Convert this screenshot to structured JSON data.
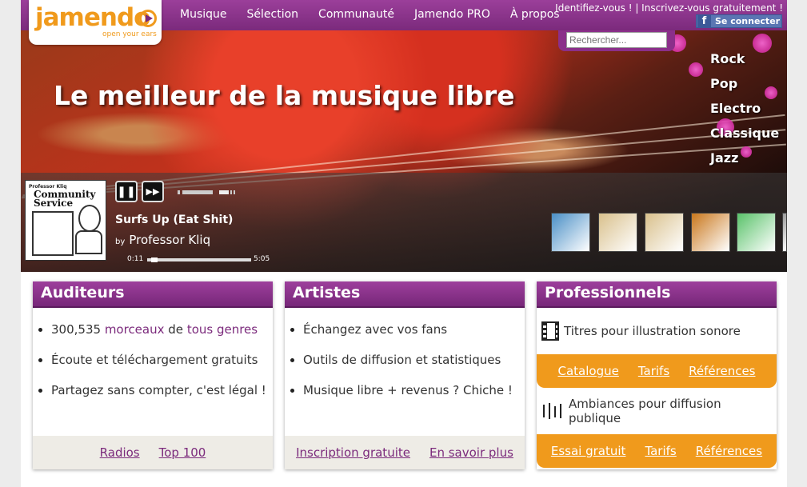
{
  "logo": {
    "word": "jamendo",
    "tagline": "open your ears"
  },
  "nav": [
    "Musique",
    "Sélection",
    "Communauté",
    "Jamendo PRO",
    "À propos"
  ],
  "account": {
    "links": "Identifiez-vous ! | Inscrivez-vous gratuitement !",
    "facebook_label": "Se connecter",
    "facebook_glyph": "f"
  },
  "search": {
    "placeholder": "Rechercher..."
  },
  "hero": {
    "headline": "Le meilleur de la musique libre"
  },
  "genres": [
    "Rock",
    "Pop",
    "Electro",
    "Classique",
    "Jazz"
  ],
  "player": {
    "cover_label": "Professor Kliq",
    "cover_title_line1": "Community",
    "cover_title_line2": "Service",
    "track_title": "Surfs Up (Eat Shit)",
    "by": "by",
    "artist": "Professor Kliq",
    "time_current": "0:11",
    "time_total": "5:05",
    "progress": 0.036,
    "pause_glyph": "❚❚",
    "next_glyph": "▶▶",
    "thumb_colors": [
      "#4a8fc6",
      "#d9c08c",
      "#d9c08c",
      "#c9771c",
      "#5ac26a",
      "#999999"
    ]
  },
  "panels": {
    "listeners": {
      "title": "Auditeurs",
      "item1_count": "300,535",
      "item1_link1": "morceaux",
      "item1_mid": "de",
      "item1_link2": "tous genres",
      "items": [
        "Écoute et téléchargement gratuits",
        "Partagez sans compter, c'est légal !"
      ],
      "links": [
        "Radios",
        "Top 100"
      ]
    },
    "artists": {
      "title": "Artistes",
      "items": [
        "Échangez avec vos fans",
        "Outils de diffusion et statistiques",
        "Musique libre + revenus ? Chiche !"
      ],
      "links": [
        "Inscription gratuite",
        "En savoir plus"
      ]
    },
    "pros": {
      "title": "Professionnels",
      "row1": "Titres pour illustration sonore",
      "row1_links": [
        "Catalogue",
        "Tarifs",
        "Références"
      ],
      "row2": "Ambiances pour diffusion publique",
      "row2_links": [
        "Essai gratuit",
        "Tarifs",
        "Références"
      ]
    }
  },
  "colors": {
    "brand_purple": "#7b2a7c",
    "brand_orange": "#f09a1c"
  }
}
